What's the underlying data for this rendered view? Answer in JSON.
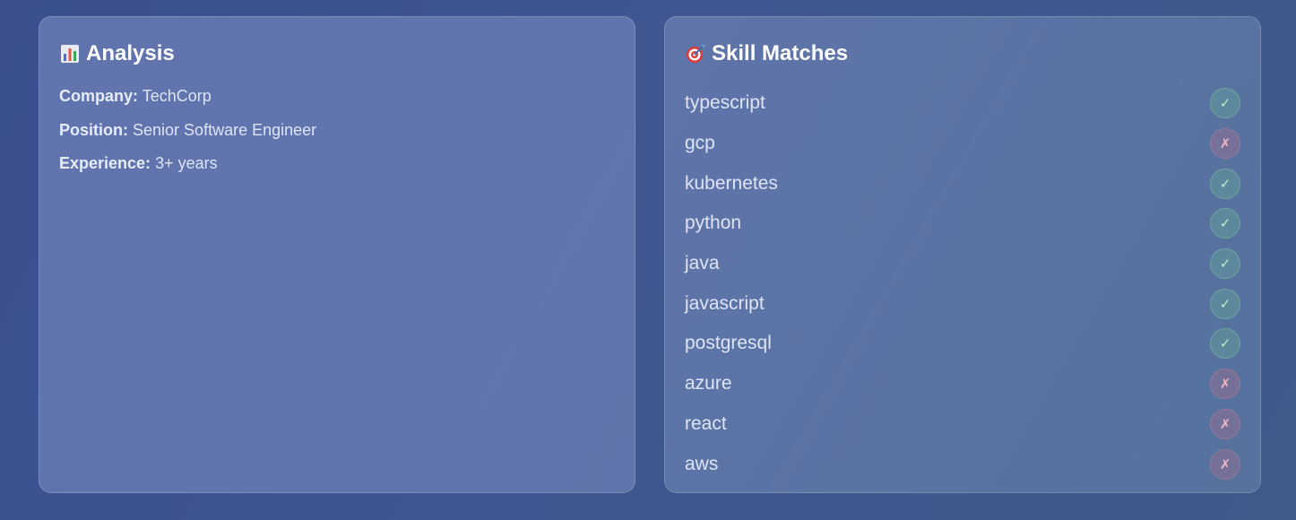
{
  "analysis": {
    "icon": "bar-chart-icon",
    "title": "Analysis",
    "rows": [
      {
        "key": "Company:",
        "value": "TechCorp"
      },
      {
        "key": "Position:",
        "value": "Senior Software Engineer"
      },
      {
        "key": "Experience:",
        "value": "3+ years"
      }
    ]
  },
  "skills": {
    "icon": "target-icon",
    "title": "Skill Matches",
    "items": [
      {
        "name": "typescript",
        "match": true,
        "mark": "✓"
      },
      {
        "name": "gcp",
        "match": false,
        "mark": "✗"
      },
      {
        "name": "kubernetes",
        "match": true,
        "mark": "✓"
      },
      {
        "name": "python",
        "match": true,
        "mark": "✓"
      },
      {
        "name": "java",
        "match": true,
        "mark": "✓"
      },
      {
        "name": "javascript",
        "match": true,
        "mark": "✓"
      },
      {
        "name": "postgresql",
        "match": true,
        "mark": "✓"
      },
      {
        "name": "azure",
        "match": false,
        "mark": "✗"
      },
      {
        "name": "react",
        "match": false,
        "mark": "✗"
      },
      {
        "name": "aws",
        "match": false,
        "mark": "✗"
      }
    ]
  },
  "colors": {
    "match": "#b8f0c8",
    "no_match": "#f0b8c4"
  }
}
